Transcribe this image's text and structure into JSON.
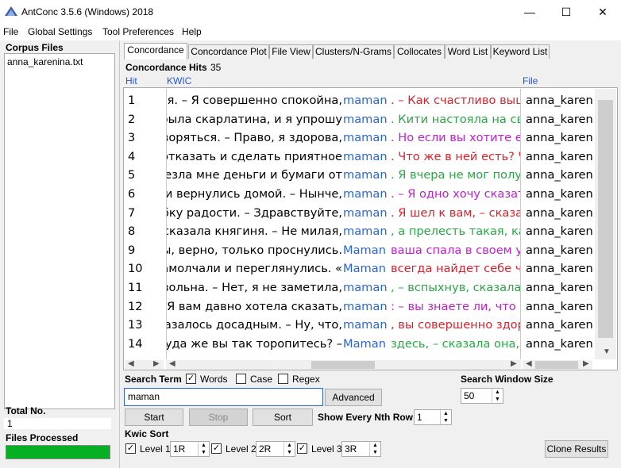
{
  "window": {
    "title": "AntConc 3.5.6 (Windows) 2018",
    "minimize": "—",
    "maximize": "☐",
    "close": "✕"
  },
  "menu": [
    "File",
    "Global Settings",
    "Tool Preferences",
    "Help"
  ],
  "sidebar": {
    "corpus_label": "Corpus Files",
    "files": [
      "anna_karenina.txt"
    ],
    "total_label": "Total No.",
    "total_value": "1",
    "processed_label": "Files Processed",
    "progress": 1.0
  },
  "tabs": [
    "Concordance",
    "Concordance Plot",
    "File View",
    "Clusters/N-Grams",
    "Collocates",
    "Word List",
    "Keyword List"
  ],
  "active_tab": "Concordance",
  "hits": {
    "label": "Concordance Hits",
    "count": "35"
  },
  "columns": {
    "hit": "Hit",
    "kwic": "KWIC",
    "file": "File"
  },
  "rows": [
    {
      "hit": "1",
      "left": "ся.  – Я совершенно спокойна, ",
      "kw": "maman",
      "right": ".  – Как счастливо вышл",
      "file": "anna_karenina"
    },
    {
      "hit": "2",
      "left": "я была скарлатина, и я упрошу ",
      "kw": "maman",
      "right": ".  Кити настояла на свое",
      "file": "anna_karenina"
    },
    {
      "hit": "3",
      "left": "творяться.  – Право, я здорова, ",
      "kw": "maman",
      "right": ". Но если вы хотите ехат",
      "file": "anna_karenina"
    },
    {
      "hit": "4",
      "left": "е отказать и сделать приятное ",
      "kw": "maman",
      "right": ". Что же в ней есть? Что",
      "file": "anna_karenina"
    },
    {
      "hit": "5",
      "left": "ивезла мне деньги и бумаги от ",
      "kw": "maman",
      "right": ". Я вчера не мог получи",
      "file": "anna_karenina"
    },
    {
      "hit": "6",
      "left": "ни вернулись домой.  – Нынче, ",
      "kw": "maman",
      "right": ".  – Я одно хочу сказать",
      "file": "anna_karenina"
    },
    {
      "hit": "7",
      "left": "ыбку радости.  – Здравствуйте, ",
      "kw": "maman",
      "right": ". Я шел к вам, – сказал с",
      "file": "anna_karenina"
    },
    {
      "hit": "8",
      "left": "- сказала княгиня.  – Не милая, ",
      "kw": "maman",
      "right": ", а прелесть такая, каки",
      "file": "anna_karenina"
    },
    {
      "hit": "9",
      "left": " Вы, верно, только проснулись. ",
      "kw": "Maman",
      "right": " ваша спала в своем угс",
      "file": "anna_karenina"
    },
    {
      "hit": "10",
      "left": "замолчали и переглянулись. « ",
      "kw": "Maman",
      "right": " всегда найдет себе что",
      "file": "anna_karenina"
    },
    {
      "hit": "11",
      "left": "овольна.  – Нет, я не заметила, ",
      "kw": "maman",
      "right": ",  – вспыхнув, сказала Ки",
      "file": "anna_karenina"
    },
    {
      "hit": "12",
      "left": " – Я вам давно хотела сказать, ",
      "kw": "maman",
      "right": ":  – вы знаете ли, что Ле",
      "file": "anna_karenina"
    },
    {
      "hit": "13",
      "left": "казалось досадным.  – Ну, что, ",
      "kw": "maman",
      "right": ", вы совершенно здоро",
      "file": "anna_karenina"
    },
    {
      "hit": "14",
      "left": "Куда же вы так торопитесь?  – ",
      "kw": "Maman",
      "right": " здесь, – сказала она, об",
      "file": "anna_karenina"
    }
  ],
  "colors": {
    "keyword": "#2a65d8",
    "red": "#e0202a",
    "green": "#28a745",
    "magenta": "#c020d0"
  },
  "search": {
    "label": "Search Term",
    "words_label": "Words",
    "words_checked": true,
    "case_label": "Case",
    "case_checked": false,
    "regex_label": "Regex",
    "regex_checked": false,
    "value": "maman",
    "advanced": "Advanced"
  },
  "window_size": {
    "label": "Search Window Size",
    "value": "50"
  },
  "buttons": {
    "start": "Start",
    "stop": "Stop",
    "sort": "Sort",
    "clone": "Clone Results"
  },
  "nth": {
    "label": "Show Every Nth Row",
    "value": "1"
  },
  "kwic_sort": {
    "label": "Kwic Sort",
    "levels": [
      {
        "label": "Level 1",
        "value": "1R",
        "checked": true
      },
      {
        "label": "Level 2",
        "value": "2R",
        "checked": true
      },
      {
        "label": "Level 3",
        "value": "3R",
        "checked": true
      }
    ]
  }
}
